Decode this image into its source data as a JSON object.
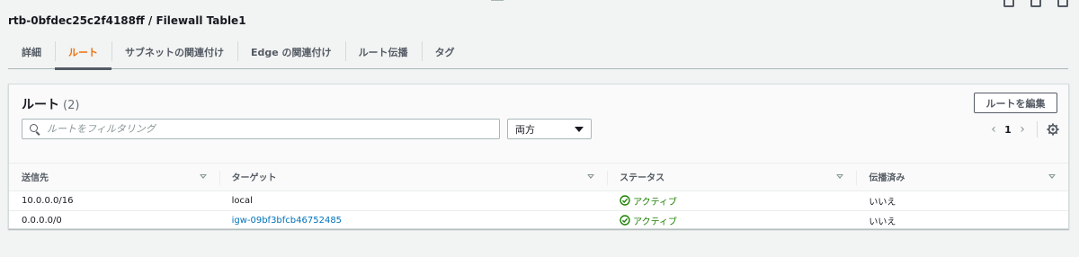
{
  "page": {
    "title": "rtb-0bfdec25c2f4188ff / Filewall Table1"
  },
  "tabs": [
    {
      "label": "詳細",
      "active": false
    },
    {
      "label": "ルート",
      "active": true
    },
    {
      "label": "サブネットの関連付け",
      "active": false
    },
    {
      "label": "Edge の関連付け",
      "active": false
    },
    {
      "label": "ルート伝播",
      "active": false
    },
    {
      "label": "タグ",
      "active": false
    }
  ],
  "routes_panel": {
    "title": "ルート",
    "count": "(2)",
    "edit_button": "ルートを編集",
    "search_placeholder": "ルートをフィルタリング",
    "filter_select_value": "両方",
    "pagination": {
      "prev_icon": "chevron-left-icon",
      "page": "1",
      "next_icon": "chevron-right-icon"
    },
    "columns": [
      "送信先",
      "ターゲット",
      "ステータス",
      "伝播済み"
    ],
    "rows": [
      {
        "destination": "10.0.0.0/16",
        "target": "local",
        "target_is_link": false,
        "status": "アクティブ",
        "propagated": "いいえ"
      },
      {
        "destination": "0.0.0.0/0",
        "target": "igw-09bf3bfcb46752485",
        "target_is_link": true,
        "status": "アクティブ",
        "propagated": "いいえ"
      }
    ]
  },
  "colors": {
    "accent": "#ec7211",
    "link": "#0073bb",
    "status_ok": "#1d8102"
  }
}
